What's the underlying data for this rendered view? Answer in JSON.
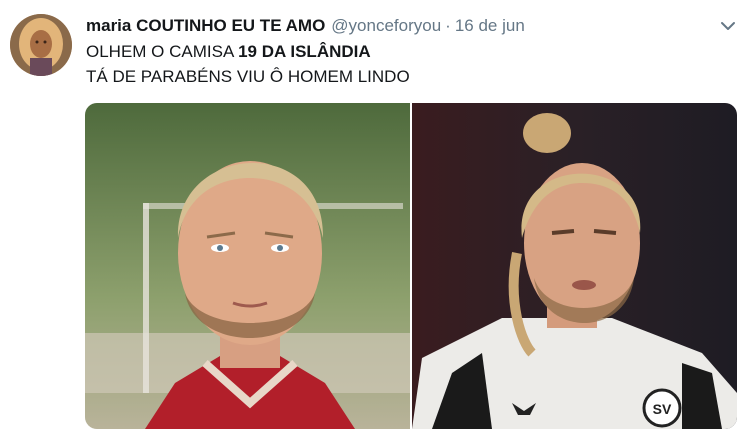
{
  "tweet": {
    "display_name": "maria COUTINHO EU TE AMO",
    "handle": "@yonceforyou",
    "separator": "·",
    "date": "16 de jun",
    "text_line1_pre": "OLHEM O CAMISA ",
    "text_line1_bold": "19 DA ISLÂNDIA",
    "text_line2": "TÁ DE PARABÉNS VIU Ô HOMEM LINDO"
  },
  "media": {
    "images": [
      {
        "description_icon": "portrait-photo-red-jersey"
      },
      {
        "description_icon": "action-photo-white-jersey"
      }
    ],
    "badge_text": "SV"
  },
  "colors": {
    "text_primary": "#14171a",
    "text_secondary": "#657786"
  }
}
